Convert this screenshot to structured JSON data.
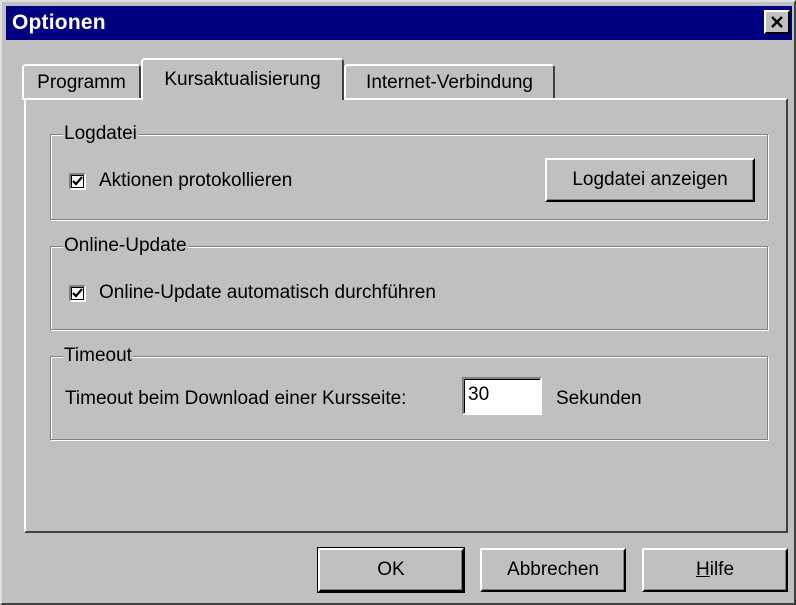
{
  "window": {
    "title": "Optionen"
  },
  "tabs": [
    {
      "label": "Programm",
      "active": false
    },
    {
      "label": "Kursaktualisierung",
      "active": true
    },
    {
      "label": "Internet-Verbindung",
      "active": false
    }
  ],
  "groups": {
    "logdatei": {
      "title": "Logdatei",
      "checkbox_label": "Aktionen protokollieren",
      "checked": true,
      "button_label": "Logdatei anzeigen"
    },
    "online_update": {
      "title": "Online-Update",
      "checkbox_label": "Online-Update automatisch durchführen",
      "checked": true
    },
    "timeout": {
      "title": "Timeout",
      "field_label": "Timeout beim Download einer Kursseite:",
      "field_value": "30",
      "unit_label": "Sekunden"
    }
  },
  "footer": {
    "ok_label": "OK",
    "cancel_label": "Abbrechen",
    "help_label_mnemonic": "H",
    "help_label_rest": "ilfe"
  },
  "colors": {
    "titlebar": "#000080",
    "face": "#c0c0c0"
  }
}
